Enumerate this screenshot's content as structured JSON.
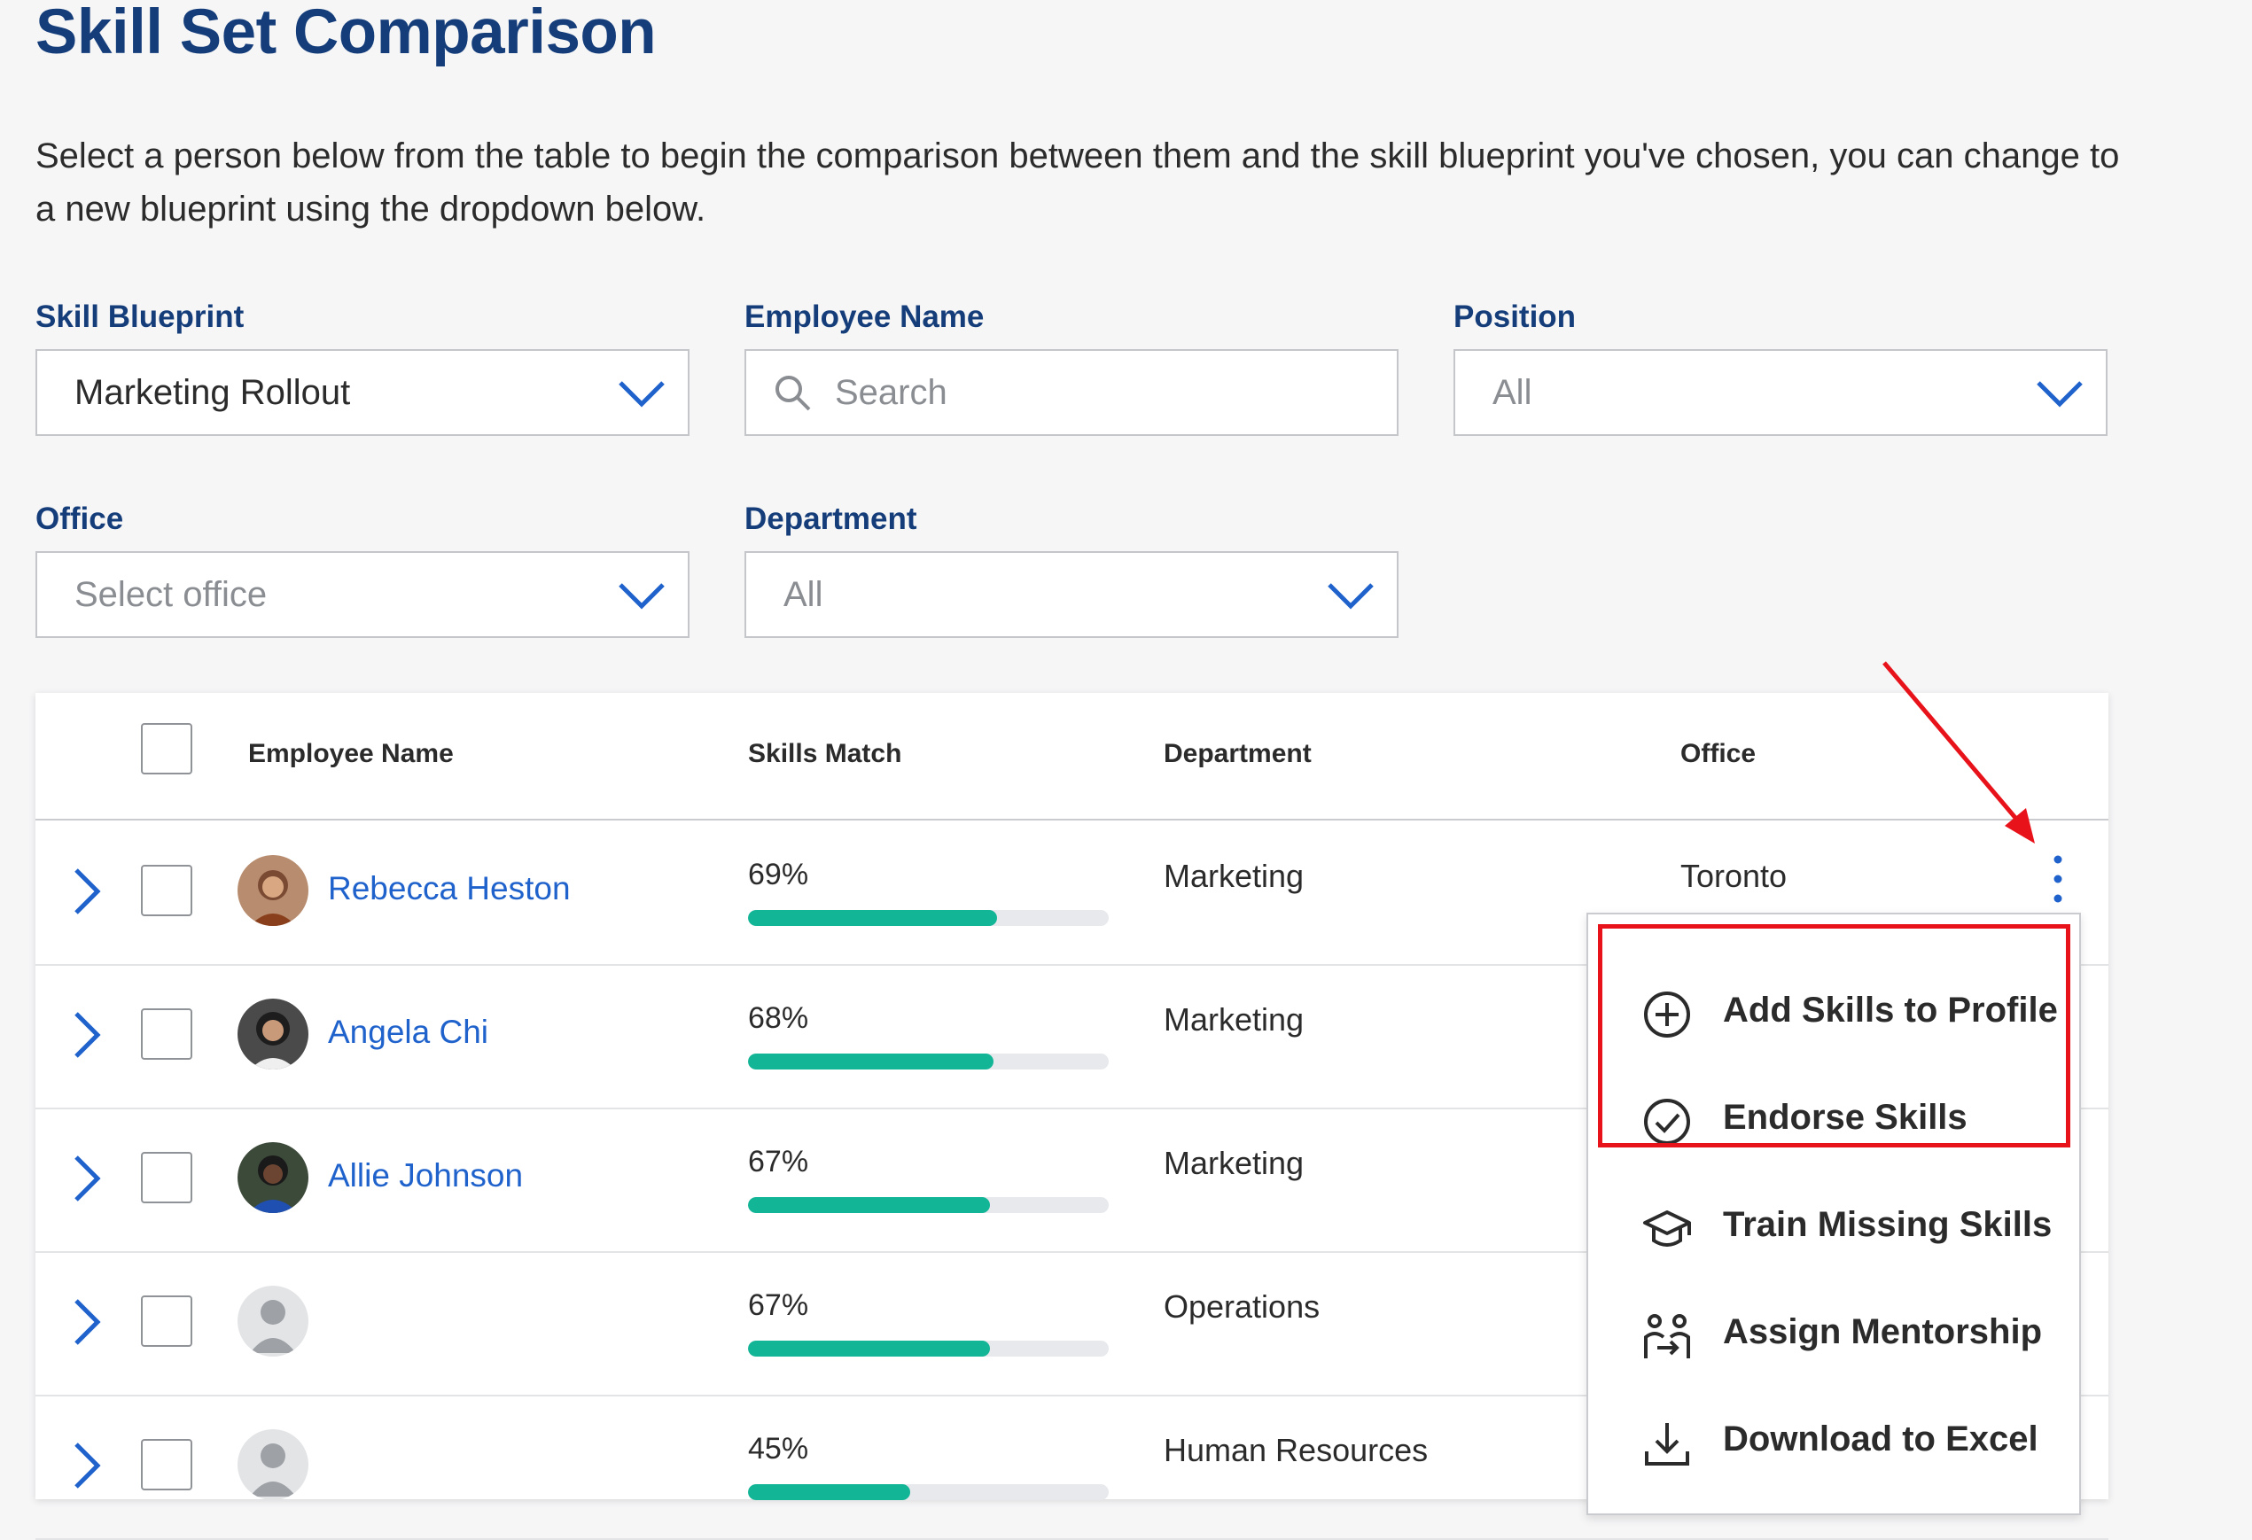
{
  "page": {
    "title": "Skill Set Comparison",
    "intro": "Select a person below from the table to begin the comparison between them and the skill blueprint you've chosen, you can change to a new blueprint using the dropdown below."
  },
  "filters": {
    "skill_blueprint": {
      "label": "Skill Blueprint",
      "value": "Marketing Rollout"
    },
    "employee_name": {
      "label": "Employee Name",
      "placeholder": "Search"
    },
    "position": {
      "label": "Position",
      "value": "All"
    },
    "office": {
      "label": "Office",
      "placeholder": "Select office"
    },
    "department": {
      "label": "Department",
      "value": "All"
    }
  },
  "table": {
    "columns": {
      "employee_name": "Employee Name",
      "skills_match": "Skills Match",
      "department": "Department",
      "office": "Office"
    },
    "rows": [
      {
        "name": "Rebecca Heston",
        "match": "69%",
        "match_value": 0.69,
        "department": "Marketing",
        "office": "Toronto",
        "avatar": "photo"
      },
      {
        "name": "Angela Chi",
        "match": "68%",
        "match_value": 0.68,
        "department": "Marketing",
        "office": "",
        "avatar": "photo"
      },
      {
        "name": "Allie Johnson",
        "match": "67%",
        "match_value": 0.67,
        "department": "Marketing",
        "office": "",
        "avatar": "photo"
      },
      {
        "name": "",
        "match": "67%",
        "match_value": 0.67,
        "department": "Operations",
        "office": "",
        "avatar": "placeholder"
      },
      {
        "name": "",
        "match": "45%",
        "match_value": 0.45,
        "department": "Human Resources",
        "office": "",
        "avatar": "placeholder"
      }
    ]
  },
  "actions_menu": {
    "items": [
      {
        "label": "Add Skills to Profile",
        "icon": "plus-circle-icon"
      },
      {
        "label": "Endorse Skills",
        "icon": "check-circle-icon"
      },
      {
        "label": "Train Missing Skills",
        "icon": "graduation-cap-icon"
      },
      {
        "label": "Assign Mentorship",
        "icon": "mentorship-icon"
      },
      {
        "label": "Download to Excel",
        "icon": "download-icon"
      }
    ]
  },
  "colors": {
    "title": "#143d7a",
    "link": "#1f62cc",
    "progress": "#13b597",
    "highlight": "#e8121a"
  }
}
